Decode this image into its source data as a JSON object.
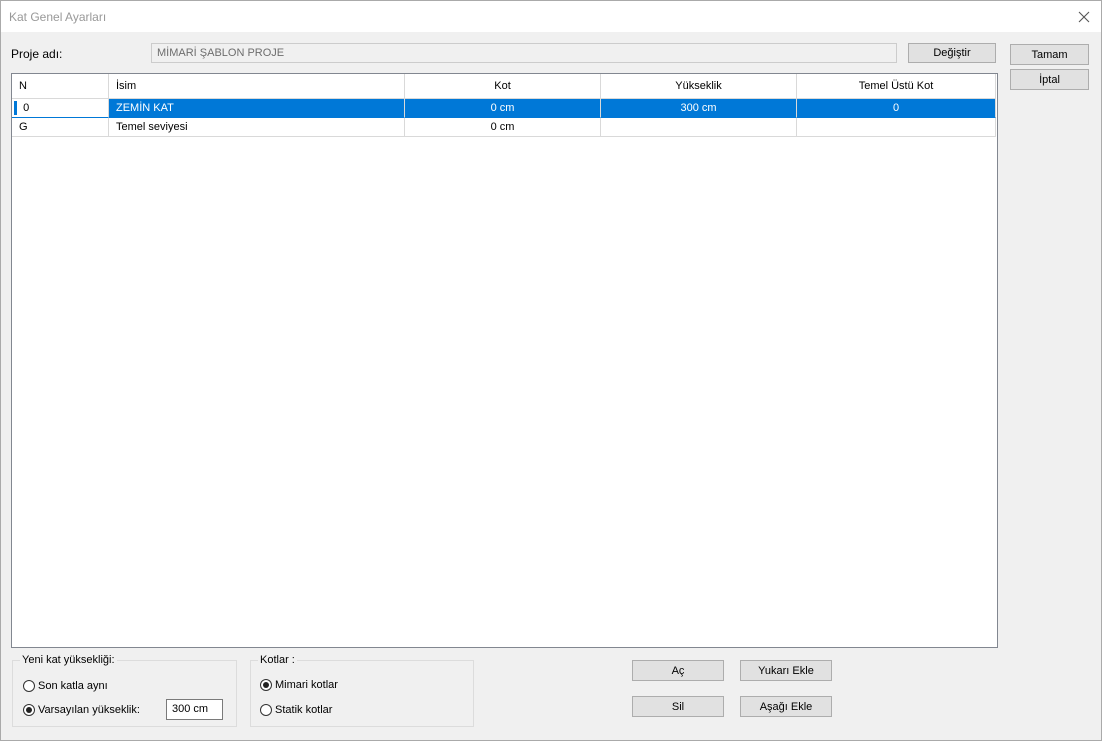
{
  "window": {
    "title": "Kat Genel Ayarları",
    "close_icon": "close-icon"
  },
  "project": {
    "label": "Proje adı:",
    "value": "MİMARİ ŞABLON PROJE",
    "change_button": "Değiştir"
  },
  "dialog": {
    "ok_button": "Tamam",
    "cancel_button": "İptal"
  },
  "table": {
    "columns": [
      "N",
      "İsim",
      "Kot",
      "Yükseklik",
      "Temel Üstü Kot"
    ],
    "rows": [
      {
        "n": "0",
        "name": "ZEMİN KAT",
        "kot": "0 cm",
        "height": "300 cm",
        "base_kot": "0",
        "selected": true
      },
      {
        "n": "G",
        "name": "Temel seviyesi",
        "kot": "0 cm",
        "height": "",
        "base_kot": "",
        "selected": false
      }
    ]
  },
  "new_floor": {
    "title": "Yeni kat yüksekliği:",
    "option_same": "Son katla aynı",
    "option_default": "Varsayılan yükseklik:",
    "selected": "default",
    "default_value": "300 cm"
  },
  "levels": {
    "title": "Kotlar :",
    "option_arch": "Mimari kotlar",
    "option_static": "Statik kotlar",
    "selected": "arch"
  },
  "actions": {
    "open": "Aç",
    "add_above": "Yukarı Ekle",
    "delete": "Sil",
    "add_below": "Aşağı Ekle"
  },
  "colors": {
    "selection": "#0078d7",
    "button_face": "#e1e1e1",
    "window_bg": "#f0f0f0"
  }
}
